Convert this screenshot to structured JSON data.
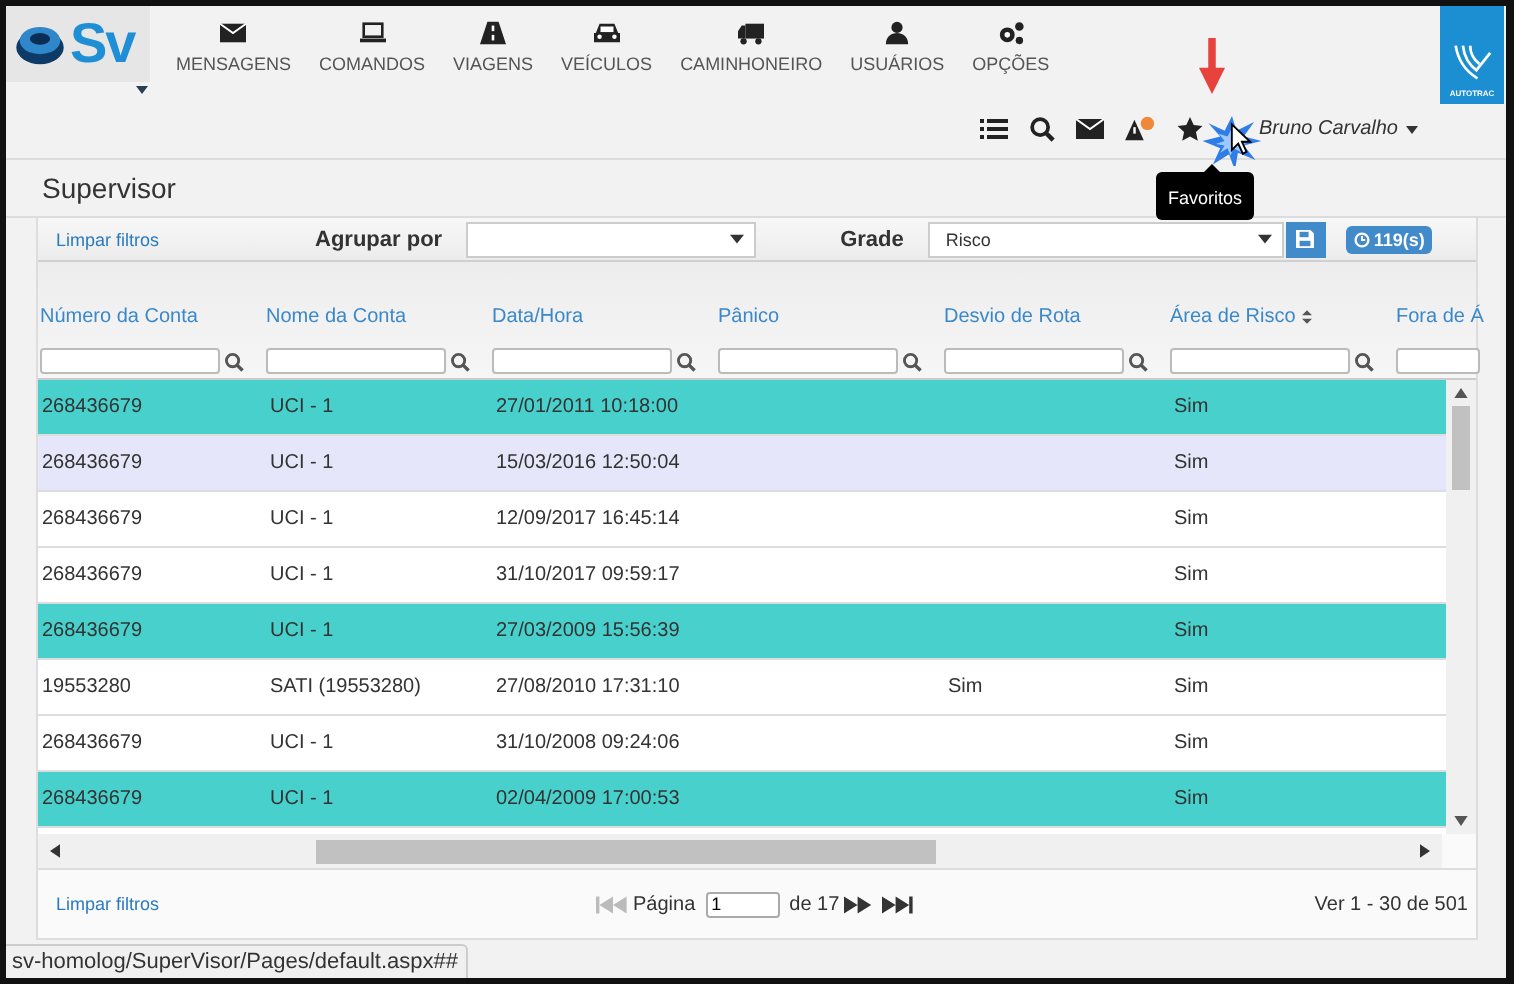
{
  "brand": {
    "logo_text": "Sv",
    "partner_logo_text": "AUTOTRAC"
  },
  "nav": [
    {
      "label": "MENSAGENS",
      "kind": "envelope"
    },
    {
      "label": "COMANDOS",
      "kind": "laptop"
    },
    {
      "label": "VIAGENS",
      "kind": "road"
    },
    {
      "label": "VEÍCULOS",
      "kind": "car"
    },
    {
      "label": "CAMINHONEIRO",
      "kind": "truck"
    },
    {
      "label": "USUÁRIOS",
      "kind": "user"
    },
    {
      "label": "OPÇÕES",
      "kind": "gears"
    }
  ],
  "toolbar": {
    "user": "Bruno Carvalho",
    "tooltip": "Favoritos"
  },
  "page_title": "Supervisor",
  "filters": {
    "clear_link": "Limpar filtros",
    "group_label": "Agrupar por",
    "grid_label": "Grade",
    "grid_value": "Risco",
    "refresh_badge": "119(s)"
  },
  "columns": [
    {
      "label": "Número da Conta",
      "sorted": false
    },
    {
      "label": "Nome da Conta",
      "sorted": false
    },
    {
      "label": "Data/Hora",
      "sorted": false
    },
    {
      "label": "Pânico",
      "sorted": false
    },
    {
      "label": "Desvio de Rota",
      "sorted": false
    },
    {
      "label": "Área de Risco",
      "sorted": true
    },
    {
      "label": "Fora de Á",
      "sorted": false
    }
  ],
  "rows": [
    {
      "color": "#48d1cc",
      "account": "268436679",
      "name": "UCI - 1",
      "datetime": "27/01/2011 10:18:00",
      "risk_area": "Sim"
    },
    {
      "color": "#e6e6fa",
      "account": "268436679",
      "name": "UCI - 1",
      "datetime": "15/03/2016 12:50:04",
      "risk_area": "Sim"
    },
    {
      "color": "#ffffff",
      "account": "268436679",
      "name": "UCI - 1",
      "datetime": "12/09/2017 16:45:14",
      "risk_area": "Sim"
    },
    {
      "color": "#ffffff",
      "account": "268436679",
      "name": "UCI - 1",
      "datetime": "31/10/2017 09:59:17",
      "risk_area": "Sim"
    },
    {
      "color": "#48d1cc",
      "account": "268436679",
      "name": "UCI - 1",
      "datetime": "27/03/2009 15:56:39",
      "risk_area": "Sim"
    },
    {
      "color": "#ffffff",
      "account": "19553280",
      "name": "SATI (19553280)",
      "datetime": "27/08/2010 17:31:10",
      "route_deviation": "Sim",
      "risk_area": "Sim"
    },
    {
      "color": "#ffffff",
      "account": "268436679",
      "name": "UCI - 1",
      "datetime": "31/10/2008 09:24:06",
      "risk_area": "Sim"
    },
    {
      "color": "#48d1cc",
      "account": "268436679",
      "name": "UCI - 1",
      "datetime": "02/04/2009 17:00:53",
      "risk_area": "Sim"
    }
  ],
  "footer": {
    "clear_link": "Limpar filtros",
    "page_label": "Página",
    "page_value": "1",
    "page_total": "de 17",
    "summary": "Ver 1 - 30 de 501"
  },
  "status_url": "sv-homolog/SuperVisor/Pages/default.aspx##"
}
